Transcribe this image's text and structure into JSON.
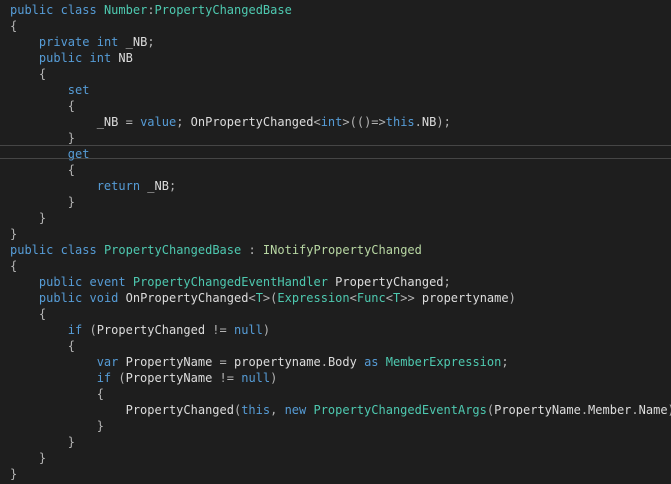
{
  "colors": {
    "background": "#1e1e1e",
    "keyword": "#569cd6",
    "type": "#4ec9b0",
    "interface": "#b8d7a3",
    "identifier": "#dcdcdc",
    "punctuation": "#b4b4b4",
    "current_line_border": "#464646"
  },
  "editor": {
    "current_line_index": 9,
    "lines": [
      [
        {
          "t": "public",
          "k": "kw"
        },
        {
          "t": " ",
          "k": "id"
        },
        {
          "t": "class",
          "k": "kw"
        },
        {
          "t": " ",
          "k": "id"
        },
        {
          "t": "Number",
          "k": "type"
        },
        {
          "t": ":",
          "k": "punc"
        },
        {
          "t": "PropertyChangedBase",
          "k": "type"
        }
      ],
      [
        {
          "t": "{",
          "k": "punc"
        }
      ],
      [
        {
          "t": "    ",
          "k": "id"
        },
        {
          "t": "private",
          "k": "kw"
        },
        {
          "t": " ",
          "k": "id"
        },
        {
          "t": "int",
          "k": "kw"
        },
        {
          "t": " _NB",
          "k": "id"
        },
        {
          "t": ";",
          "k": "punc"
        }
      ],
      [
        {
          "t": "    ",
          "k": "id"
        },
        {
          "t": "public",
          "k": "kw"
        },
        {
          "t": " ",
          "k": "id"
        },
        {
          "t": "int",
          "k": "kw"
        },
        {
          "t": " NB",
          "k": "id"
        }
      ],
      [
        {
          "t": "    ",
          "k": "id"
        },
        {
          "t": "{",
          "k": "punc"
        }
      ],
      [
        {
          "t": "        ",
          "k": "id"
        },
        {
          "t": "set",
          "k": "kw"
        }
      ],
      [
        {
          "t": "        ",
          "k": "id"
        },
        {
          "t": "{",
          "k": "punc"
        }
      ],
      [
        {
          "t": "            _NB ",
          "k": "id"
        },
        {
          "t": "=",
          "k": "punc"
        },
        {
          "t": " ",
          "k": "id"
        },
        {
          "t": "value",
          "k": "kw"
        },
        {
          "t": ";",
          "k": "punc"
        },
        {
          "t": " OnPropertyChanged",
          "k": "id"
        },
        {
          "t": "<",
          "k": "punc"
        },
        {
          "t": "int",
          "k": "kw"
        },
        {
          "t": ">",
          "k": "punc"
        },
        {
          "t": "(()=>",
          "k": "punc"
        },
        {
          "t": "this",
          "k": "kw"
        },
        {
          "t": ".",
          "k": "punc"
        },
        {
          "t": "NB",
          "k": "id"
        },
        {
          "t": ");",
          "k": "punc"
        }
      ],
      [
        {
          "t": "        ",
          "k": "id"
        },
        {
          "t": "}",
          "k": "punc"
        }
      ],
      [
        {
          "t": "        ",
          "k": "id"
        },
        {
          "t": "get",
          "k": "kw"
        }
      ],
      [
        {
          "t": "        ",
          "k": "id"
        },
        {
          "t": "{",
          "k": "punc"
        }
      ],
      [
        {
          "t": "            ",
          "k": "id"
        },
        {
          "t": "return",
          "k": "kw"
        },
        {
          "t": " _NB",
          "k": "id"
        },
        {
          "t": ";",
          "k": "punc"
        }
      ],
      [
        {
          "t": "        ",
          "k": "id"
        },
        {
          "t": "}",
          "k": "punc"
        }
      ],
      [
        {
          "t": "    ",
          "k": "id"
        },
        {
          "t": "}",
          "k": "punc"
        }
      ],
      [
        {
          "t": "}",
          "k": "punc"
        }
      ],
      [
        {
          "t": "public",
          "k": "kw"
        },
        {
          "t": " ",
          "k": "id"
        },
        {
          "t": "class",
          "k": "kw"
        },
        {
          "t": " ",
          "k": "id"
        },
        {
          "t": "PropertyChangedBase",
          "k": "type"
        },
        {
          "t": " : ",
          "k": "punc"
        },
        {
          "t": "INotifyPropertyChanged",
          "k": "iface"
        }
      ],
      [
        {
          "t": "{",
          "k": "punc"
        }
      ],
      [
        {
          "t": "    ",
          "k": "id"
        },
        {
          "t": "public",
          "k": "kw"
        },
        {
          "t": " ",
          "k": "id"
        },
        {
          "t": "event",
          "k": "kw"
        },
        {
          "t": " ",
          "k": "id"
        },
        {
          "t": "PropertyChangedEventHandler",
          "k": "type"
        },
        {
          "t": " PropertyChanged",
          "k": "id"
        },
        {
          "t": ";",
          "k": "punc"
        }
      ],
      [
        {
          "t": "    ",
          "k": "id"
        },
        {
          "t": "public",
          "k": "kw"
        },
        {
          "t": " ",
          "k": "id"
        },
        {
          "t": "void",
          "k": "kw"
        },
        {
          "t": " OnPropertyChanged",
          "k": "id"
        },
        {
          "t": "<",
          "k": "punc"
        },
        {
          "t": "T",
          "k": "type"
        },
        {
          "t": ">(",
          "k": "punc"
        },
        {
          "t": "Expression",
          "k": "type"
        },
        {
          "t": "<",
          "k": "punc"
        },
        {
          "t": "Func",
          "k": "type"
        },
        {
          "t": "<",
          "k": "punc"
        },
        {
          "t": "T",
          "k": "type"
        },
        {
          "t": ">>",
          "k": "punc"
        },
        {
          "t": " propertyname",
          "k": "id"
        },
        {
          "t": ")",
          "k": "punc"
        }
      ],
      [
        {
          "t": "    ",
          "k": "id"
        },
        {
          "t": "{",
          "k": "punc"
        }
      ],
      [
        {
          "t": "        ",
          "k": "id"
        },
        {
          "t": "if",
          "k": "kw"
        },
        {
          "t": " (",
          "k": "punc"
        },
        {
          "t": "PropertyChanged ",
          "k": "id"
        },
        {
          "t": "!=",
          "k": "punc"
        },
        {
          "t": " ",
          "k": "id"
        },
        {
          "t": "null",
          "k": "kw"
        },
        {
          "t": ")",
          "k": "punc"
        }
      ],
      [
        {
          "t": "        ",
          "k": "id"
        },
        {
          "t": "{",
          "k": "punc"
        }
      ],
      [
        {
          "t": "            ",
          "k": "id"
        },
        {
          "t": "var",
          "k": "kw"
        },
        {
          "t": " PropertyName ",
          "k": "id"
        },
        {
          "t": "=",
          "k": "punc"
        },
        {
          "t": " propertyname",
          "k": "id"
        },
        {
          "t": ".",
          "k": "punc"
        },
        {
          "t": "Body ",
          "k": "id"
        },
        {
          "t": "as",
          "k": "kw"
        },
        {
          "t": " ",
          "k": "id"
        },
        {
          "t": "MemberExpression",
          "k": "type"
        },
        {
          "t": ";",
          "k": "punc"
        }
      ],
      [
        {
          "t": "            ",
          "k": "id"
        },
        {
          "t": "if",
          "k": "kw"
        },
        {
          "t": " (",
          "k": "punc"
        },
        {
          "t": "PropertyName ",
          "k": "id"
        },
        {
          "t": "!=",
          "k": "punc"
        },
        {
          "t": " ",
          "k": "id"
        },
        {
          "t": "null",
          "k": "kw"
        },
        {
          "t": ")",
          "k": "punc"
        }
      ],
      [
        {
          "t": "            ",
          "k": "id"
        },
        {
          "t": "{",
          "k": "punc"
        }
      ],
      [
        {
          "t": "                PropertyChanged",
          "k": "id"
        },
        {
          "t": "(",
          "k": "punc"
        },
        {
          "t": "this",
          "k": "kw"
        },
        {
          "t": ", ",
          "k": "punc"
        },
        {
          "t": "new",
          "k": "kw"
        },
        {
          "t": " ",
          "k": "id"
        },
        {
          "t": "PropertyChangedEventArgs",
          "k": "type"
        },
        {
          "t": "(",
          "k": "punc"
        },
        {
          "t": "PropertyName",
          "k": "id"
        },
        {
          "t": ".",
          "k": "punc"
        },
        {
          "t": "Member",
          "k": "id"
        },
        {
          "t": ".",
          "k": "punc"
        },
        {
          "t": "Name",
          "k": "id"
        },
        {
          "t": "));",
          "k": "punc"
        }
      ],
      [
        {
          "t": "            ",
          "k": "id"
        },
        {
          "t": "}",
          "k": "punc"
        }
      ],
      [
        {
          "t": "        ",
          "k": "id"
        },
        {
          "t": "}",
          "k": "punc"
        }
      ],
      [
        {
          "t": "    ",
          "k": "id"
        },
        {
          "t": "}",
          "k": "punc"
        }
      ],
      [
        {
          "t": "}",
          "k": "punc"
        }
      ]
    ]
  }
}
